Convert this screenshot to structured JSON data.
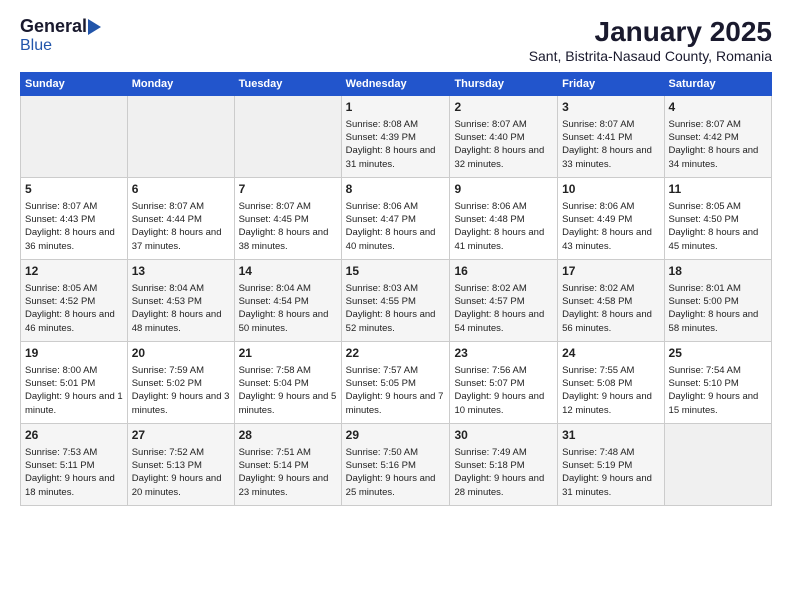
{
  "logo": {
    "general": "General",
    "blue": "Blue"
  },
  "title": "January 2025",
  "subtitle": "Sant, Bistrita-Nasaud County, Romania",
  "days_header": [
    "Sunday",
    "Monday",
    "Tuesday",
    "Wednesday",
    "Thursday",
    "Friday",
    "Saturday"
  ],
  "weeks": [
    [
      {
        "day": "",
        "content": ""
      },
      {
        "day": "",
        "content": ""
      },
      {
        "day": "",
        "content": ""
      },
      {
        "day": "1",
        "content": "Sunrise: 8:08 AM\nSunset: 4:39 PM\nDaylight: 8 hours and 31 minutes."
      },
      {
        "day": "2",
        "content": "Sunrise: 8:07 AM\nSunset: 4:40 PM\nDaylight: 8 hours and 32 minutes."
      },
      {
        "day": "3",
        "content": "Sunrise: 8:07 AM\nSunset: 4:41 PM\nDaylight: 8 hours and 33 minutes."
      },
      {
        "day": "4",
        "content": "Sunrise: 8:07 AM\nSunset: 4:42 PM\nDaylight: 8 hours and 34 minutes."
      }
    ],
    [
      {
        "day": "5",
        "content": "Sunrise: 8:07 AM\nSunset: 4:43 PM\nDaylight: 8 hours and 36 minutes."
      },
      {
        "day": "6",
        "content": "Sunrise: 8:07 AM\nSunset: 4:44 PM\nDaylight: 8 hours and 37 minutes."
      },
      {
        "day": "7",
        "content": "Sunrise: 8:07 AM\nSunset: 4:45 PM\nDaylight: 8 hours and 38 minutes."
      },
      {
        "day": "8",
        "content": "Sunrise: 8:06 AM\nSunset: 4:47 PM\nDaylight: 8 hours and 40 minutes."
      },
      {
        "day": "9",
        "content": "Sunrise: 8:06 AM\nSunset: 4:48 PM\nDaylight: 8 hours and 41 minutes."
      },
      {
        "day": "10",
        "content": "Sunrise: 8:06 AM\nSunset: 4:49 PM\nDaylight: 8 hours and 43 minutes."
      },
      {
        "day": "11",
        "content": "Sunrise: 8:05 AM\nSunset: 4:50 PM\nDaylight: 8 hours and 45 minutes."
      }
    ],
    [
      {
        "day": "12",
        "content": "Sunrise: 8:05 AM\nSunset: 4:52 PM\nDaylight: 8 hours and 46 minutes."
      },
      {
        "day": "13",
        "content": "Sunrise: 8:04 AM\nSunset: 4:53 PM\nDaylight: 8 hours and 48 minutes."
      },
      {
        "day": "14",
        "content": "Sunrise: 8:04 AM\nSunset: 4:54 PM\nDaylight: 8 hours and 50 minutes."
      },
      {
        "day": "15",
        "content": "Sunrise: 8:03 AM\nSunset: 4:55 PM\nDaylight: 8 hours and 52 minutes."
      },
      {
        "day": "16",
        "content": "Sunrise: 8:02 AM\nSunset: 4:57 PM\nDaylight: 8 hours and 54 minutes."
      },
      {
        "day": "17",
        "content": "Sunrise: 8:02 AM\nSunset: 4:58 PM\nDaylight: 8 hours and 56 minutes."
      },
      {
        "day": "18",
        "content": "Sunrise: 8:01 AM\nSunset: 5:00 PM\nDaylight: 8 hours and 58 minutes."
      }
    ],
    [
      {
        "day": "19",
        "content": "Sunrise: 8:00 AM\nSunset: 5:01 PM\nDaylight: 9 hours and 1 minute."
      },
      {
        "day": "20",
        "content": "Sunrise: 7:59 AM\nSunset: 5:02 PM\nDaylight: 9 hours and 3 minutes."
      },
      {
        "day": "21",
        "content": "Sunrise: 7:58 AM\nSunset: 5:04 PM\nDaylight: 9 hours and 5 minutes."
      },
      {
        "day": "22",
        "content": "Sunrise: 7:57 AM\nSunset: 5:05 PM\nDaylight: 9 hours and 7 minutes."
      },
      {
        "day": "23",
        "content": "Sunrise: 7:56 AM\nSunset: 5:07 PM\nDaylight: 9 hours and 10 minutes."
      },
      {
        "day": "24",
        "content": "Sunrise: 7:55 AM\nSunset: 5:08 PM\nDaylight: 9 hours and 12 minutes."
      },
      {
        "day": "25",
        "content": "Sunrise: 7:54 AM\nSunset: 5:10 PM\nDaylight: 9 hours and 15 minutes."
      }
    ],
    [
      {
        "day": "26",
        "content": "Sunrise: 7:53 AM\nSunset: 5:11 PM\nDaylight: 9 hours and 18 minutes."
      },
      {
        "day": "27",
        "content": "Sunrise: 7:52 AM\nSunset: 5:13 PM\nDaylight: 9 hours and 20 minutes."
      },
      {
        "day": "28",
        "content": "Sunrise: 7:51 AM\nSunset: 5:14 PM\nDaylight: 9 hours and 23 minutes."
      },
      {
        "day": "29",
        "content": "Sunrise: 7:50 AM\nSunset: 5:16 PM\nDaylight: 9 hours and 25 minutes."
      },
      {
        "day": "30",
        "content": "Sunrise: 7:49 AM\nSunset: 5:18 PM\nDaylight: 9 hours and 28 minutes."
      },
      {
        "day": "31",
        "content": "Sunrise: 7:48 AM\nSunset: 5:19 PM\nDaylight: 9 hours and 31 minutes."
      },
      {
        "day": "",
        "content": ""
      }
    ]
  ]
}
